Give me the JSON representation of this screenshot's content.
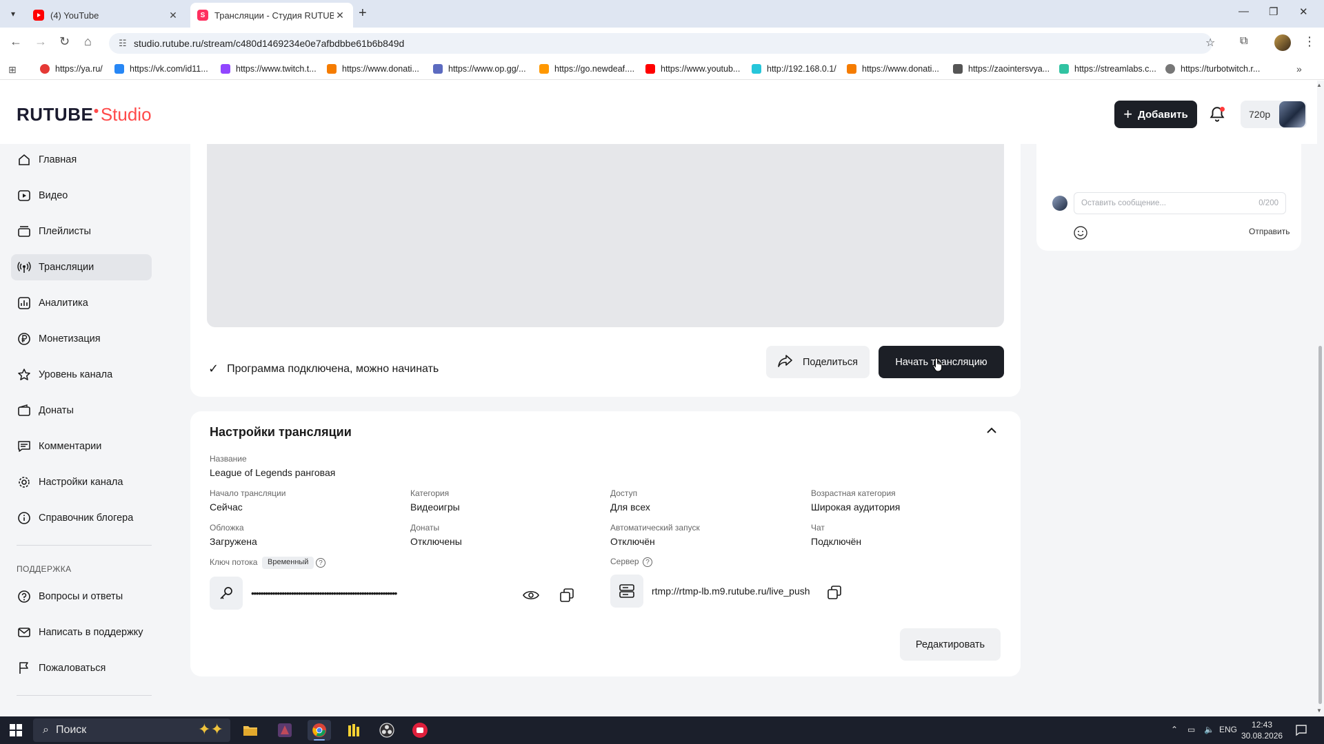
{
  "browser": {
    "tabs": [
      {
        "title": "(4) YouTube",
        "close": "✕"
      },
      {
        "title": "Трансляции - Студия RUTUBE",
        "close": "✕"
      }
    ],
    "new_tab": "+",
    "url": "studio.rutube.ru/stream/c480d1469234e0e7afbdbbe61b6b849d",
    "bookmarks": [
      {
        "label": "https://ya.ru/",
        "color": "#e53935"
      },
      {
        "label": "https://vk.com/id11...",
        "color": "#2787f5"
      },
      {
        "label": "https://www.twitch.t...",
        "color": "#9146ff"
      },
      {
        "label": "https://www.donati...",
        "color": "#f57c00"
      },
      {
        "label": "https://www.op.gg/...",
        "color": "#5c6bc0"
      },
      {
        "label": "https://go.newdeaf....",
        "color": "#ff9800"
      },
      {
        "label": "https://www.youtub...",
        "color": "#ff0000"
      },
      {
        "label": "http://192.168.0.1/",
        "color": "#26c6da"
      },
      {
        "label": "https://www.donati...",
        "color": "#f57c00"
      },
      {
        "label": "https://zaointersvya...",
        "color": "#555555"
      },
      {
        "label": "https://streamlabs.c...",
        "color": "#31c3a2"
      },
      {
        "label": "https://turbotwitch.r...",
        "color": "#777777"
      }
    ]
  },
  "header": {
    "logo_brand": "RUTUBE",
    "logo_studio": "Studio",
    "add_button": "Добавить",
    "quality": "720p"
  },
  "sidebar": {
    "items": [
      {
        "label": "Главная",
        "icon": "home-icon"
      },
      {
        "label": "Видео",
        "icon": "video-icon"
      },
      {
        "label": "Плейлисты",
        "icon": "playlist-icon"
      },
      {
        "label": "Трансляции",
        "icon": "broadcast-icon",
        "active": true
      },
      {
        "label": "Аналитика",
        "icon": "analytics-icon"
      },
      {
        "label": "Монетизация",
        "icon": "ruble-icon"
      },
      {
        "label": "Уровень канала",
        "icon": "star-icon"
      },
      {
        "label": "Донаты",
        "icon": "wallet-icon"
      },
      {
        "label": "Комментарии",
        "icon": "comment-icon"
      },
      {
        "label": "Настройки канала",
        "icon": "gear-icon"
      },
      {
        "label": "Справочник блогера",
        "icon": "info-icon"
      }
    ],
    "support_title": "ПОДДЕРЖКА",
    "support_items": [
      {
        "label": "Вопросы и ответы",
        "icon": "question-icon"
      },
      {
        "label": "Написать в поддержку",
        "icon": "mail-icon"
      },
      {
        "label": "Пожаловаться",
        "icon": "flag-icon"
      }
    ]
  },
  "stream": {
    "status": "Программа подключена, можно начинать",
    "share_button": "Поделиться",
    "start_button": "Начать трансляцию"
  },
  "settings": {
    "title": "Настройки трансляции",
    "name_label": "Название",
    "name_value": "League of Legends ранговая",
    "fields": [
      {
        "label": "Начало трансляции",
        "value": "Сейчас"
      },
      {
        "label": "Категория",
        "value": "Видеоигры"
      },
      {
        "label": "Доступ",
        "value": "Для всех"
      },
      {
        "label": "Возрастная категория",
        "value": "Широкая аудитория"
      },
      {
        "label": "Обложка",
        "value": "Загружена"
      },
      {
        "label": "Донаты",
        "value": "Отключены"
      },
      {
        "label": "Автоматический запуск",
        "value": "Отключён"
      },
      {
        "label": "Чат",
        "value": "Подключён"
      }
    ],
    "key_label": "Ключ потока",
    "key_badge": "Временный",
    "key_value": "••••••••••••••••••••••••••••••••••••••••••••••••••••••••••••••",
    "server_label": "Сервер",
    "server_value": "rtmp://rtmp-lb.m9.rutube.ru/live_push",
    "edit_button": "Редактировать"
  },
  "chat": {
    "placeholder": "Оставить сообщение...",
    "counter": "0/200",
    "send": "Отправить"
  },
  "taskbar": {
    "search": "Поиск",
    "lang": "ENG",
    "time": "12:43",
    "date": "30.08.2026"
  }
}
